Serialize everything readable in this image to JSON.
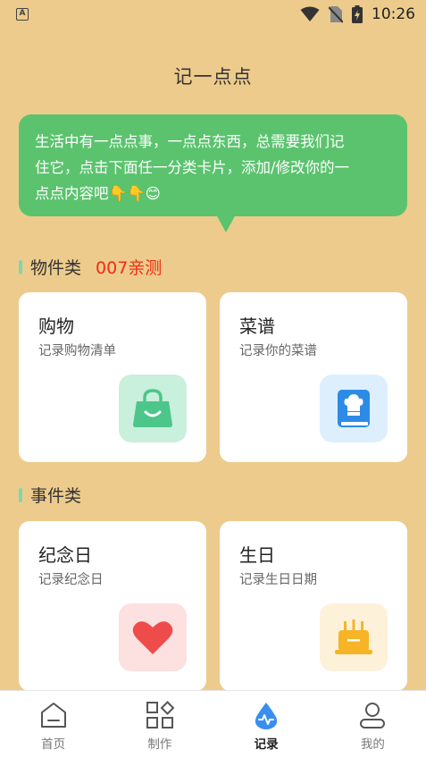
{
  "status_bar": {
    "time": "10:26"
  },
  "page_title": "记一点点",
  "intro": {
    "line1": "生活中有一点点事，一点点东西，总需要我们记",
    "line2": "住它，点击下面任一分类卡片，添加/修改你的一",
    "line3": "点点内容吧👇👇😊"
  },
  "sections": [
    {
      "label": "物件类",
      "tag": "007亲测"
    },
    {
      "label": "事件类"
    }
  ],
  "cards": [
    {
      "title": "购物",
      "subtitle": "记录购物清单",
      "icon": "shopping-bag-icon",
      "icon_bg": "#C9F0DD",
      "icon_color": "#4CC68A"
    },
    {
      "title": "菜谱",
      "subtitle": "记录你的菜谱",
      "icon": "recipe-book-icon",
      "icon_bg": "#DDEFFD",
      "icon_color": "#2D8BE6"
    },
    {
      "title": "纪念日",
      "subtitle": "记录纪念日",
      "icon": "heart-icon",
      "icon_bg": "#FDE0E0",
      "icon_color": "#EE4B4B"
    },
    {
      "title": "生日",
      "subtitle": "记录生日日期",
      "icon": "birthday-cake-icon",
      "icon_bg": "#FEF1D9",
      "icon_color": "#F6B426"
    }
  ],
  "tabs": [
    {
      "label": "首页",
      "icon": "home-icon",
      "active": false
    },
    {
      "label": "制作",
      "icon": "apps-icon",
      "active": false
    },
    {
      "label": "记录",
      "icon": "record-icon",
      "active": true
    },
    {
      "label": "我的",
      "icon": "profile-icon",
      "active": false
    }
  ]
}
